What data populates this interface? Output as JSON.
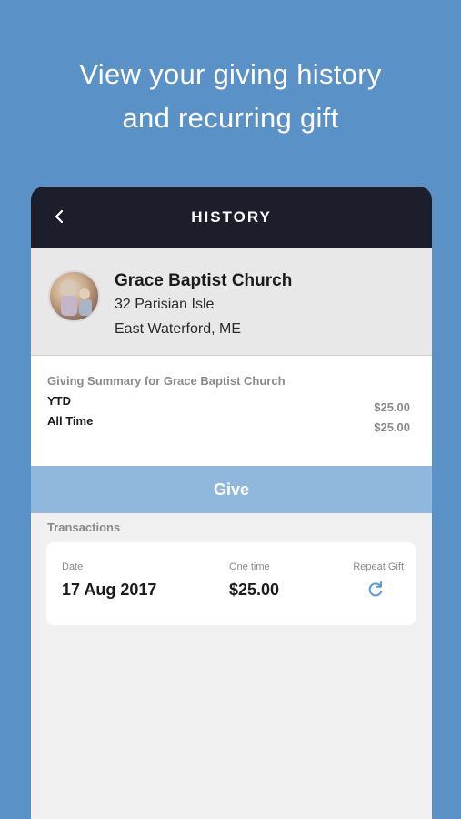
{
  "promo": {
    "line1": "View your giving history",
    "line2": "and recurring gift"
  },
  "navbar": {
    "back_icon": "chevron-left-icon",
    "title": "HISTORY"
  },
  "church": {
    "name": "Grace Baptist Church",
    "address_line1": "32 Parisian Isle",
    "address_line2": "East Waterford, ME"
  },
  "summary": {
    "title": "Giving Summary for Grace Baptist Church",
    "rows": [
      {
        "label": "YTD",
        "value": "$25.00"
      },
      {
        "label": "All Time",
        "value": "$25.00"
      }
    ]
  },
  "give_button": {
    "label": "Give"
  },
  "transactions": {
    "heading": "Transactions",
    "items": [
      {
        "date_label": "Date",
        "date": "17 Aug 2017",
        "type_label": "One time",
        "amount": "$25.00",
        "repeat_label": "Repeat Gift",
        "repeat_icon": "refresh-icon"
      }
    ]
  },
  "colors": {
    "background": "#5a91c6",
    "navbar": "#1c1f2b",
    "give_button": "#8fb8dc",
    "accent_icon": "#5a9ad6"
  }
}
